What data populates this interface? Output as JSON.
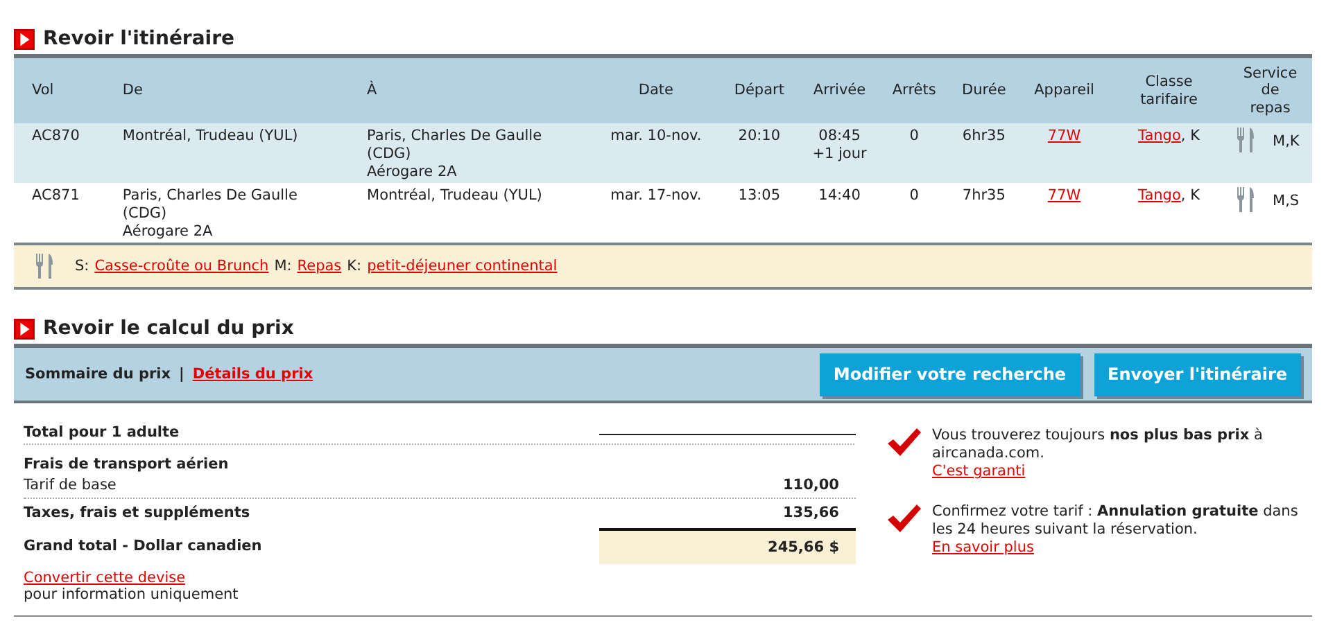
{
  "itinerary": {
    "title": "Revoir l'itinéraire",
    "columns": [
      "Vol",
      "De",
      "À",
      "Date",
      "Départ",
      "Arrivée",
      "Arrêts",
      "Durée",
      "Appareil",
      "Classe tarifaire",
      "Service de repas"
    ],
    "rows": [
      {
        "flight": "AC870",
        "from": [
          "Montréal, Trudeau (YUL)"
        ],
        "to": [
          "Paris, Charles De Gaulle (CDG)",
          "Aérogare 2A"
        ],
        "date": "mar. 10-nov.",
        "departure": "20:10",
        "arrival": [
          "08:45",
          "+1 jour"
        ],
        "stops": "0",
        "duration": "6hr35",
        "aircraft": "77W",
        "fare_class": "Tango",
        "fare_code": ", K",
        "meals": "M,K"
      },
      {
        "flight": "AC871",
        "from": [
          "Paris, Charles De Gaulle (CDG)",
          "Aérogare 2A"
        ],
        "to": [
          "Montréal, Trudeau (YUL)"
        ],
        "date": "mar. 17-nov.",
        "departure": "13:05",
        "arrival": [
          "14:40"
        ],
        "stops": "0",
        "duration": "7hr35",
        "aircraft": "77W",
        "fare_class": "Tango",
        "fare_code": ", K",
        "meals": "M,S"
      }
    ],
    "legend": [
      {
        "code": "S:",
        "label": "Casse-croûte ou Brunch"
      },
      {
        "code": "M:",
        "label": "Repas"
      },
      {
        "code": "K:",
        "label": "petit-déjeuner continental"
      }
    ]
  },
  "price": {
    "title": "Revoir le calcul du prix",
    "tabs": [
      {
        "label": "Sommaire du prix",
        "selected": true
      },
      {
        "label": "Détails du prix",
        "selected": false
      }
    ],
    "separator": "|",
    "buttons": [
      "Modifier votre recherche",
      "Envoyer l'itinéraire"
    ],
    "lines": [
      {
        "kind": "heading",
        "label": "Total pour 1 adulte"
      },
      {
        "kind": "group",
        "label": "Frais de transport aérien"
      },
      {
        "kind": "item",
        "label": "Tarif de base",
        "amount": "110,00"
      },
      {
        "kind": "bold_item",
        "label": "Taxes, frais et suppléments",
        "amount": "135,66"
      },
      {
        "kind": "total",
        "label": "Grand total - Dollar canadien",
        "amount": "245,66 $"
      }
    ],
    "convert_link": "Convertir cette devise",
    "convert_note": "pour information uniquement",
    "promises": [
      {
        "text": "Vous trouverez toujours **nos plus bas prix** à aircanada.com.",
        "link": "C'est garanti"
      },
      {
        "text": "Confirmez votre tarif : **Annulation gratuite** dans les 24 heures suivant la réservation.",
        "link": "En savoir plus"
      }
    ]
  }
}
